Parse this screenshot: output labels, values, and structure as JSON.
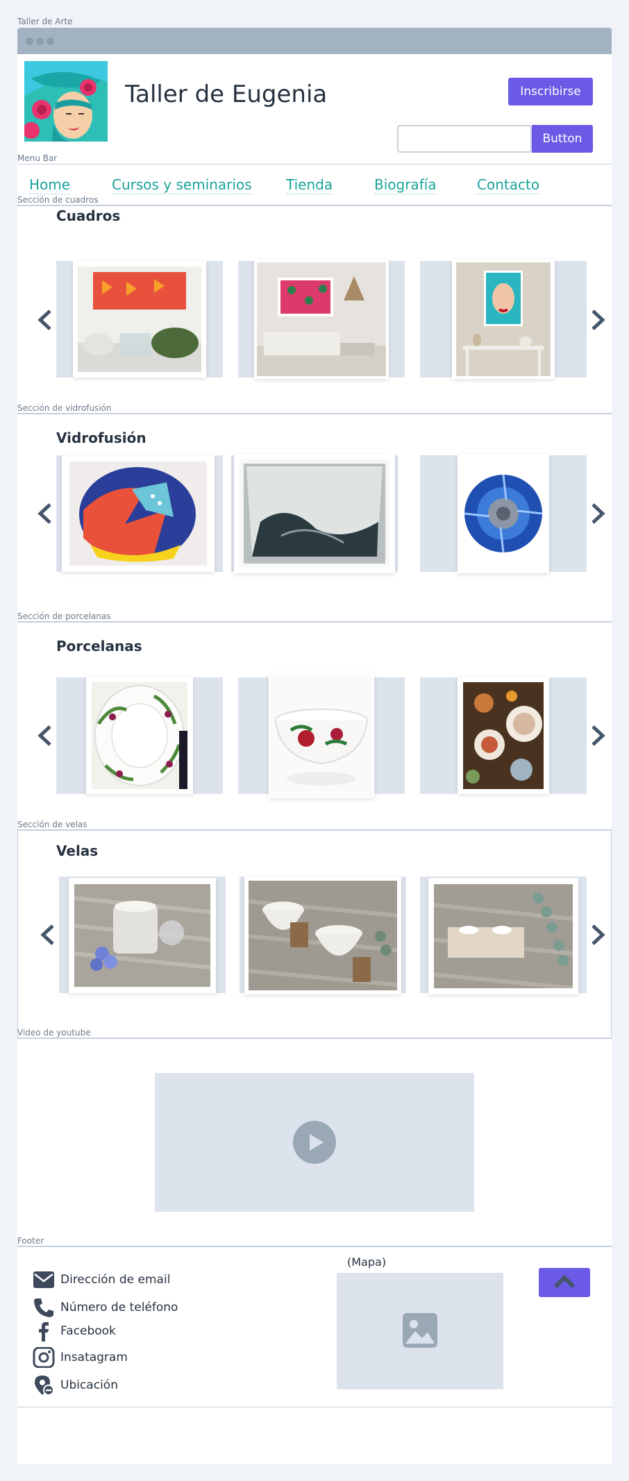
{
  "frame_label": "Taller de Arte",
  "header": {
    "title": "Taller de Eugenia",
    "signup_label": "Inscribirse",
    "search_button_label": "Button",
    "search_placeholder": ""
  },
  "labels": {
    "menu_bar": "Menu Bar",
    "cuadros": "Sección de cuadros",
    "vidrofusion": "Sección de vidrofusión",
    "porcelanas": "Sección de porcelanas",
    "velas": "Sección de velas",
    "video": "Video de youtube",
    "footer": "Footer"
  },
  "nav": {
    "items": [
      {
        "label": "Home"
      },
      {
        "label": "Cursos y seminarios"
      },
      {
        "label": "Tienda"
      },
      {
        "label": "Biografía"
      },
      {
        "label": "Contacto"
      }
    ]
  },
  "sections": {
    "cuadros": {
      "title": "Cuadros"
    },
    "vidrofusion": {
      "title": "Vidrofusión"
    },
    "porcelanas": {
      "title": "Porcelanas"
    },
    "velas": {
      "title": "Velas"
    }
  },
  "footer": {
    "items": [
      {
        "label": "Dirección de email",
        "icon": "envelope-icon"
      },
      {
        "label": "Número de teléfono",
        "icon": "phone-icon"
      },
      {
        "label": "Facebook",
        "icon": "facebook-icon"
      },
      {
        "label": "Insatagram",
        "icon": "instagram-icon"
      },
      {
        "label": "Ubicación",
        "icon": "location-pin-icon"
      }
    ],
    "map_label": "(Mapa)"
  },
  "colors": {
    "accent": "#6a5ae6",
    "link": "#1aa39a",
    "placeholder": "#dde3ec"
  }
}
